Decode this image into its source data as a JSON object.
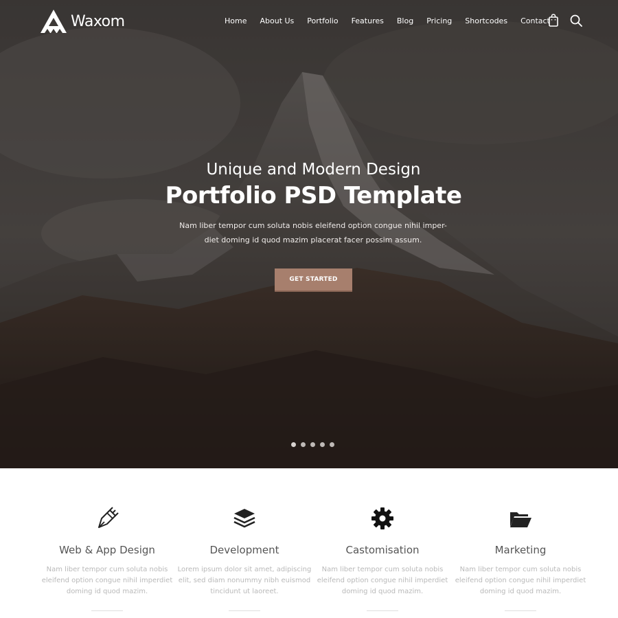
{
  "brand": {
    "name": "Waxom"
  },
  "nav": {
    "items": [
      "Home",
      "About Us",
      "Portfolio",
      "Features",
      "Blog",
      "Pricing",
      "Shortcodes",
      "Contact"
    ],
    "cart_icon": "shopping-bag-icon",
    "search_icon": "search-icon"
  },
  "hero": {
    "subtitle": "Unique and Modern Design",
    "title": "Portfolio PSD Template",
    "description": "Nam liber tempor cum soluta nobis eleifend option congue nihil imper-diet doming id quod mazim placerat facer possim assum.",
    "cta_label": "GET STARTED",
    "slider_dots": 5,
    "active_dot": 0
  },
  "features": [
    {
      "icon": "pen-nib-icon",
      "title": "Web & App Design",
      "description": "Nam liber tempor cum soluta nobis eleifend option congue nihil imperdiet doming id quod mazim."
    },
    {
      "icon": "layers-icon",
      "title": "Development",
      "description": "Lorem ipsum dolor sit amet, adipiscing elit, sed diam nonummy nibh euismod tincidunt ut laoreet."
    },
    {
      "icon": "gear-icon",
      "title": "Castomisation",
      "description": "Nam liber tempor cum soluta nobis eleifend option congue nihil imperdiet doming id quod mazim."
    },
    {
      "icon": "folder-icon",
      "title": "Marketing",
      "description": "Nam liber tempor cum soluta nobis eleifend option congue nihil imperdiet doming id quod mazim."
    }
  ],
  "colors": {
    "accent": "#a77f6d",
    "text_dark": "#555555",
    "text_muted": "#b9b9b9"
  }
}
